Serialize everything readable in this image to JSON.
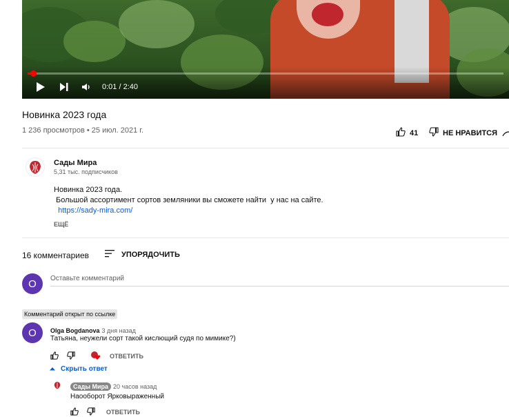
{
  "player": {
    "time": "0:01 / 2:40",
    "progress": 0.006
  },
  "video": {
    "title": "Новинка 2023 года",
    "meta": "1 236 просмотров • 25 июл. 2021 г.",
    "likes": "41",
    "dislike_label": "НЕ НРАВИТСЯ"
  },
  "channel": {
    "name": "Сады Мира",
    "subscribers": "5,31 тыс. подписчиков",
    "logo_icon": "strawberry-logo-icon",
    "brand_color": "#c0262e"
  },
  "description": {
    "line1": "Новинка 2023 года.",
    "line2": " Большой ассортимент сортов земляники вы сможете найти  у нас на сайте.",
    "link": "https://sady-mira.com/",
    "more": "ЕЩЁ"
  },
  "comments": {
    "count": "16 комментариев",
    "sort_label": "УПОРЯДОЧИТЬ",
    "input_placeholder": "Оставьте комментарий",
    "user_initial": "O",
    "avatar_color": "#5e35b1",
    "linked_badge": "Комментарий открыт по ссылке",
    "items": [
      {
        "initial": "O",
        "author": "Olga Bogdanova",
        "ago": "3 дня назад",
        "text": "Татьяна, неужели сорт такой кислющий судя по мимике?)",
        "reply_label": "ОТВЕТИТЬ",
        "hide_replies": "Скрыть ответ"
      }
    ],
    "replies": [
      {
        "author": "Сады Мира",
        "ago": "20 часов назад",
        "text": "Наооборот Ярковыраженный",
        "reply_label": "ОТВЕТИТЬ"
      }
    ]
  }
}
